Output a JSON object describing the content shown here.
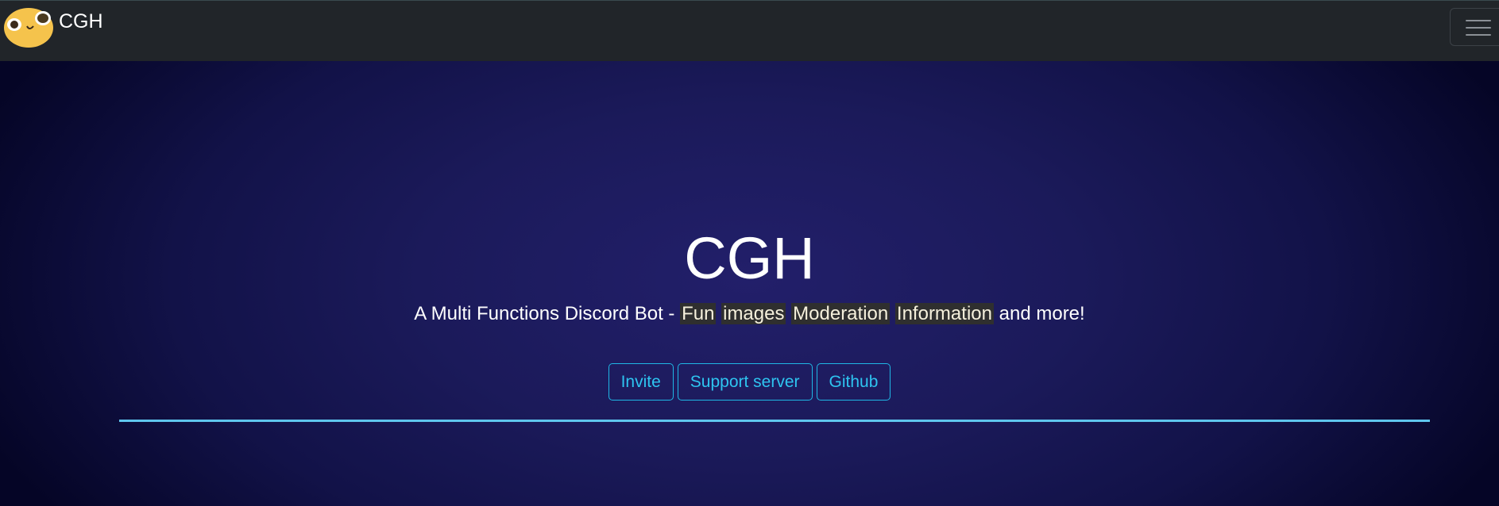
{
  "navbar": {
    "brand": "CGH",
    "logo_icon": "smiling-face-logo-icon",
    "menu_icon": "hamburger-menu-icon"
  },
  "hero": {
    "title": "CGH",
    "tagline_prefix": "A Multi Functions Discord Bot - ",
    "tags": [
      "Fun",
      "images",
      "Moderation",
      "Information"
    ],
    "tagline_suffix": " and more!",
    "buttons": {
      "invite": "Invite",
      "support": "Support server",
      "github": "Github"
    }
  },
  "colors": {
    "navbar_bg": "#212529",
    "accent": "#2ec4f0",
    "divider": "#5fc6ee",
    "logo": "#f5c34c"
  }
}
